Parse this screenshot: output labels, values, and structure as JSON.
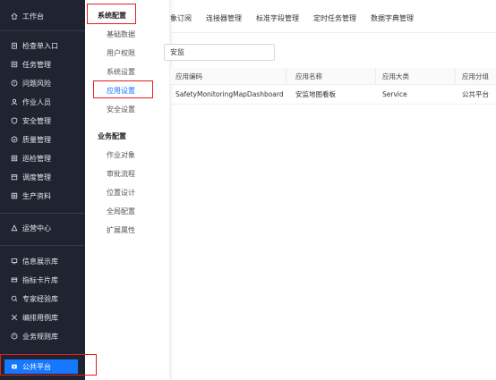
{
  "sidebar": {
    "workbench": "工作台",
    "items": [
      {
        "label": "检查单入口",
        "icon": "clipboard-icon"
      },
      {
        "label": "任务管理",
        "icon": "task-icon"
      },
      {
        "label": "问题风险",
        "icon": "warning-icon"
      },
      {
        "label": "作业人员",
        "icon": "user-icon"
      },
      {
        "label": "安全管理",
        "icon": "shield-icon"
      },
      {
        "label": "质量管理",
        "icon": "quality-icon"
      },
      {
        "label": "巡检管理",
        "icon": "inspect-icon"
      },
      {
        "label": "调度管理",
        "icon": "schedule-icon"
      },
      {
        "label": "生产资料",
        "icon": "material-icon"
      }
    ],
    "ops": "运营中心",
    "items2": [
      {
        "label": "信息展示库",
        "icon": "display-icon"
      },
      {
        "label": "指标卡片库",
        "icon": "card-icon"
      },
      {
        "label": "专家经验库",
        "icon": "expert-icon"
      },
      {
        "label": "编排用例库",
        "icon": "orchestrate-icon"
      },
      {
        "label": "业务规则库",
        "icon": "rule-icon"
      }
    ],
    "public_platform": "公共平台"
  },
  "flyout": {
    "group1_title": "系统配置",
    "group1_items": [
      "基础数据",
      "用户权限",
      "系统设置",
      "应用设置",
      "安全设置"
    ],
    "group2_title": "业务配置",
    "group2_items": [
      "作业对象",
      "审批流程",
      "位置设计",
      "全局配置",
      "扩展属性"
    ],
    "selected": "应用设置"
  },
  "tabs": [
    "象订阅",
    "连接器管理",
    "标准字段管理",
    "定时任务管理",
    "数据字典管理"
  ],
  "search": {
    "value": "安监"
  },
  "table": {
    "headers": [
      "应用编码",
      "应用名称",
      "应用大类",
      "应用分组"
    ],
    "rows": [
      [
        "SafetyMonitoringMapDashboard",
        "安监地图看板",
        "Service",
        "公共平台"
      ]
    ]
  },
  "colors": {
    "sidebar_bg": "#1f2430",
    "accent": "#1677ff",
    "highlight_box": "#e02020"
  }
}
